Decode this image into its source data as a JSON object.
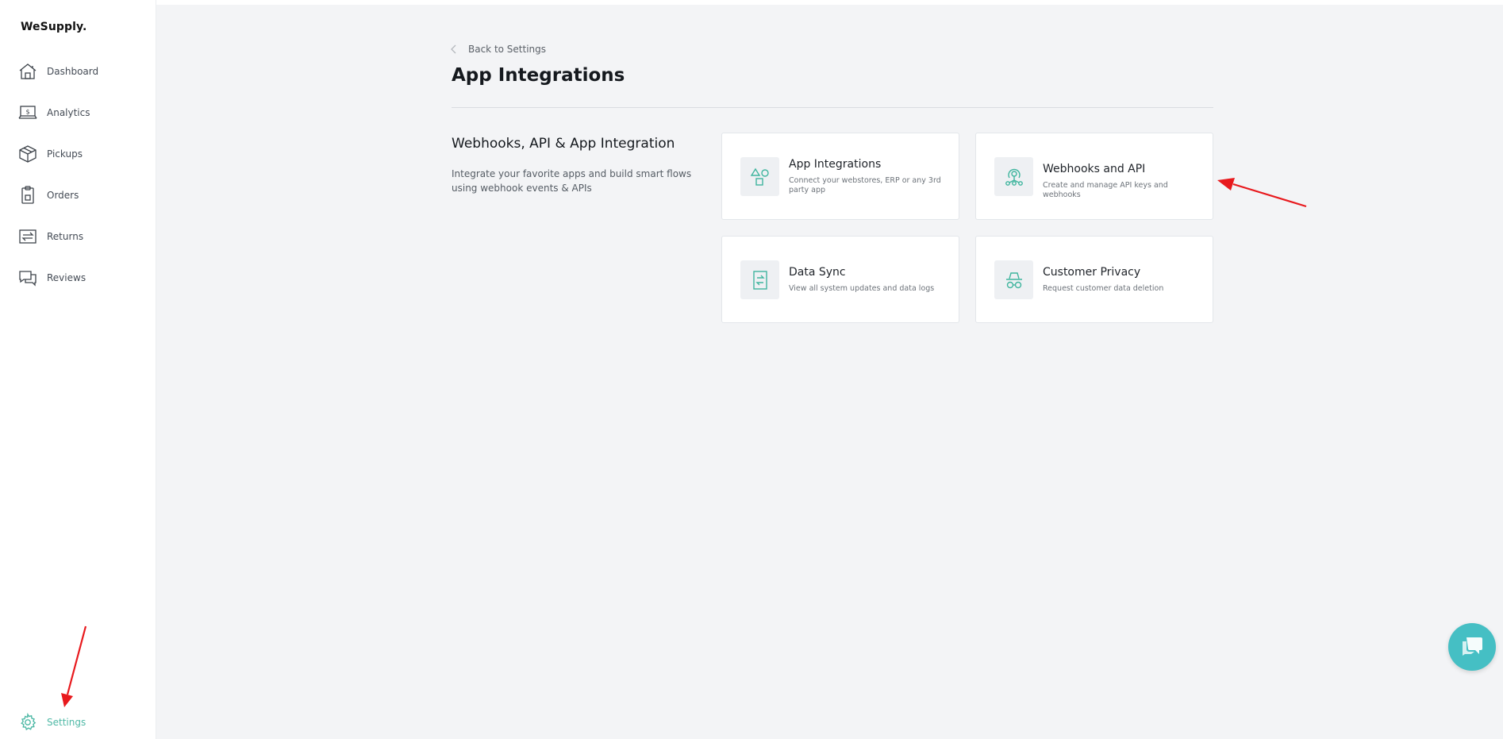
{
  "app": {
    "logo": "WeSupply."
  },
  "sidebar": {
    "items": [
      {
        "label": "Dashboard",
        "icon": "house-icon"
      },
      {
        "label": "Analytics",
        "icon": "laptop-dollar-icon"
      },
      {
        "label": "Pickups",
        "icon": "box-icon"
      },
      {
        "label": "Orders",
        "icon": "clipboard-icon"
      },
      {
        "label": "Returns",
        "icon": "returns-icon"
      },
      {
        "label": "Reviews",
        "icon": "chat-bubbles-icon"
      }
    ],
    "settings": {
      "label": "Settings",
      "icon": "gear-icon"
    }
  },
  "main": {
    "back_label": "Back to Settings",
    "title": "App Integrations",
    "section": {
      "title": "Webhooks, API & App Integration",
      "description": "Integrate your favorite apps and build smart flows using webhook events & APIs"
    },
    "cards": [
      {
        "title": "App Integrations",
        "description": "Connect your webstores, ERP or any 3rd party app",
        "icon": "shapes-icon"
      },
      {
        "title": "Webhooks and API",
        "description": "Create and manage API keys and webhooks",
        "icon": "webhook-icon"
      },
      {
        "title": "Data Sync",
        "description": "View all system updates and data logs",
        "icon": "sync-document-icon"
      },
      {
        "title": "Customer Privacy",
        "description": "Request customer data deletion",
        "icon": "incognito-icon"
      }
    ]
  },
  "colors": {
    "accent": "#4fb9a6",
    "chat": "#45bfc4",
    "annotation": "#e8191d"
  }
}
